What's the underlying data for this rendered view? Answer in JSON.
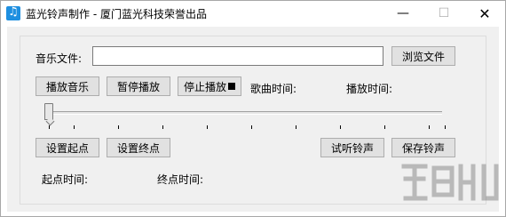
{
  "window": {
    "title": "蓝光铃声制作 - 厦门蓝光科技荣誉出品",
    "min_glyph": "—",
    "max_glyph": "☐",
    "close_glyph": "✕",
    "icon": "music-note-icon"
  },
  "form": {
    "music_file_label": "音乐文件:",
    "music_file_value": "",
    "browse_label": "浏览文件",
    "play_label": "播放音乐",
    "pause_label": "暂停播放",
    "stop_label": "停止播放",
    "song_time_label": "歌曲时间:",
    "play_time_label": "播放时间:",
    "set_start_label": "设置起点",
    "set_end_label": "设置终点",
    "preview_label": "试听铃声",
    "save_label": "保存铃声",
    "start_time_label": "起点时间:",
    "end_time_label": "终点时间:",
    "slider_position": 0
  },
  "colors": {
    "window_bg": "#ffffff",
    "client_bg": "#f0f0f0",
    "button_bg": "#e1e1e1",
    "icon_blue": "#1e8fe0"
  }
}
